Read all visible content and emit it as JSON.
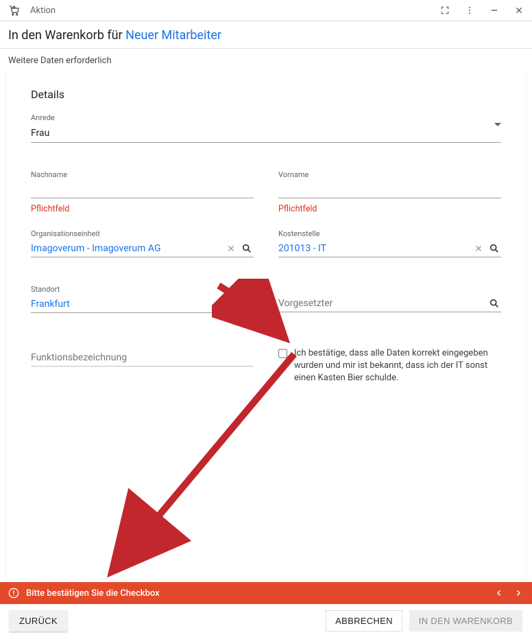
{
  "titlebar": {
    "title": "Aktion"
  },
  "header": {
    "prefix": "In den Warenkorb für ",
    "target": "Neuer Mitarbeiter"
  },
  "subheader": "Weitere Daten erforderlich",
  "section_title": "Details",
  "fields": {
    "salutation": {
      "label": "Anrede",
      "value": "Frau"
    },
    "lastname": {
      "label": "Nachname",
      "error": "Pflichtfeld"
    },
    "firstname": {
      "label": "Vorname",
      "error": "Pflichtfeld"
    },
    "orgunit": {
      "label": "Organisationseinheit",
      "value": "Imagoverum - Imagoverum AG"
    },
    "costcenter": {
      "label": "Kostenstelle",
      "value": "201013 - IT"
    },
    "location": {
      "label": "Standort",
      "value": "Frankfurt"
    },
    "manager": {
      "placeholder": "Vorgesetzter"
    },
    "jobtitle": {
      "placeholder": "Funktionsbezeichnung"
    },
    "confirm": {
      "label": "Ich bestätige, dass alle Daten korrekt eingegeben wurden und mir ist bekannt, dass ich der IT sonst einen Kasten Bier schulde."
    }
  },
  "error_bar": {
    "message": "Bitte bestätigen Sie die Checkbox"
  },
  "footer": {
    "back": "ZURÜCK",
    "cancel": "ABBRECHEN",
    "add": "IN DEN WARENKORB"
  }
}
